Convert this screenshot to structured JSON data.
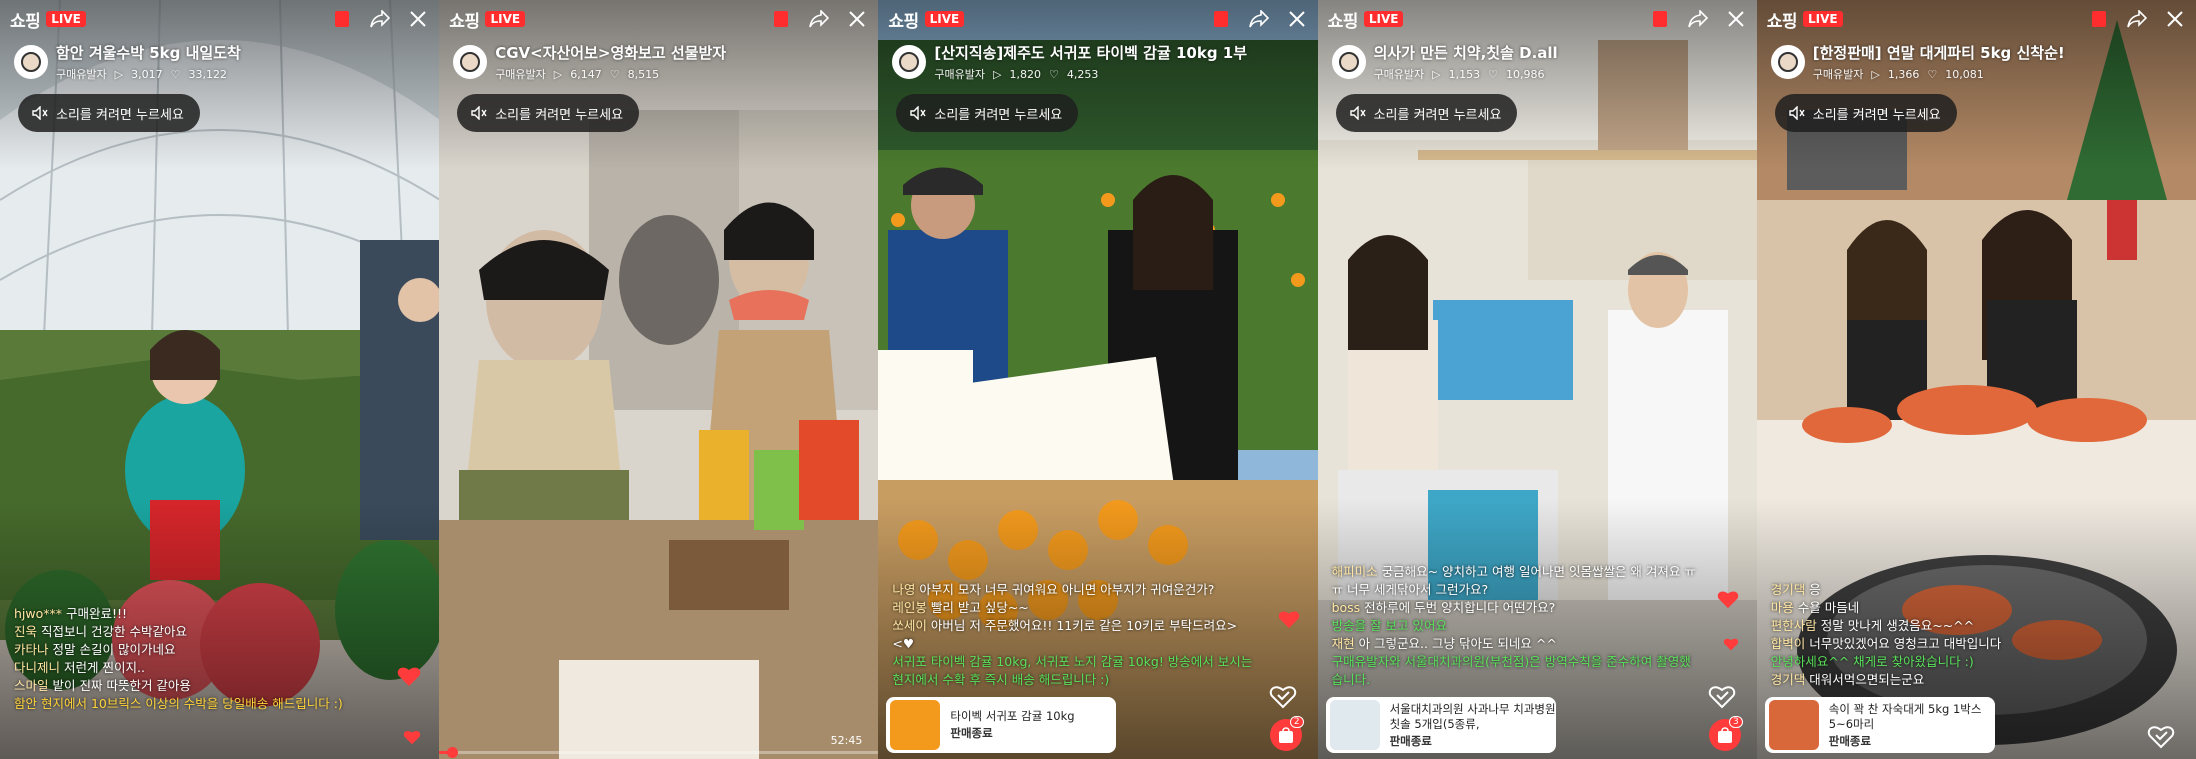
{
  "colors": {
    "live": "#ff2d2d",
    "accent": "#ff3b3b",
    "chat_green": "#59e05a",
    "chat_yellow": "#ffd33a"
  },
  "panels": [
    {
      "brand": "쇼핑",
      "live": "LIVE",
      "title": "함안 겨울수박 5kg 내일도착",
      "channel": "구매유발자",
      "plays": "3,017",
      "likes": "33,122",
      "sound": "소리를 켜려면 누르세요",
      "chat": [
        {
          "user": "hjwo***",
          "text": "구매완료!!!"
        },
        {
          "user": "진욱",
          "text": "직접보니 건강한 수박같아요"
        },
        {
          "user": "카타나",
          "text": "정말 손길이 많이가네요"
        },
        {
          "user": "다니제니",
          "text": "저런게 찐이지.."
        },
        {
          "user": "스마일",
          "text": "밭이 진짜 따뜻한거 같아용"
        },
        {
          "user": "",
          "text": "함안 현지에서 10브릭스 이상의 수박을 당일배송 해드립니다 :)"
        }
      ]
    },
    {
      "brand": "쇼핑",
      "live": "LIVE",
      "title": "CGV<자산어보>영화보고 선물받자",
      "channel": "구매유발자",
      "plays": "6,147",
      "likes": "8,515",
      "sound": "소리를 켜려면 누르세요",
      "time": "52:45",
      "progress": 0.03
    },
    {
      "brand": "쇼핑",
      "live": "LIVE",
      "title": "[산지직송]제주도 서귀포 타이벡 감귤 10kg 1부",
      "channel": "구매유발자",
      "plays": "1,820",
      "likes": "4,253",
      "sound": "소리를 켜려면 누르세요",
      "chat": [
        {
          "user": "나영",
          "text": "아부지 모자 너무 귀여워요 아니면 아부지가 귀여운건가?"
        },
        {
          "user": "레인봉",
          "text": "빨리 받고 싶당~~"
        },
        {
          "user": "쏘세이",
          "text": "아버님 저 주문했어요!! 11키로 같은 10키로 부탁드려요> <♥"
        },
        {
          "user": "",
          "text": "서귀포 타이벡 감귤 10kg, 서귀포 노지 감귤 10kg! 방송에서 보시는 현지에서 수확 후 즉시 배송 해드립니다 :)"
        }
      ],
      "product": {
        "title": "타이벡 서귀포 감귤 10kg",
        "status": "판매종료"
      },
      "cart_count": "2"
    },
    {
      "brand": "쇼핑",
      "live": "LIVE",
      "title": "의사가 만든 치약,칫솔 D.all",
      "channel": "구매유발자",
      "plays": "1,153",
      "likes": "10,986",
      "sound": "소리를 켜려면 누르세요",
      "chat": [
        {
          "user": "해피미소",
          "text": "궁금해요~ 양치하고 여행 일어나면 잇몸쌉쌀은 왜 겨져요 ㅠㅠ 너무 세게닦아서 그런가요?"
        },
        {
          "user": "boss",
          "text": "전하루에 두번 양치합니다 어떤가요?"
        },
        {
          "user": "",
          "text": "방송을 잘 보고 있어요"
        },
        {
          "user": "재현",
          "text": "아 그렇군요.. 그냥 닦아도 되네요 ^^"
        },
        {
          "user": "",
          "text": "구매유발자와 서울대치과의원(부천점)은 방역수칙을 준수하여 촬영했습니다."
        }
      ],
      "product": {
        "title": "서울대치과의원 사과나무 치과병원 칫솔 5개입(5종류,",
        "status": "판매종료"
      },
      "cart_count": "3"
    },
    {
      "brand": "쇼핑",
      "live": "LIVE",
      "title": "[한정판매] 연말 대게파티 5kg 신착순!",
      "channel": "구매유발자",
      "plays": "1,366",
      "likes": "10,081",
      "sound": "소리를 켜려면 누르세요",
      "chat": [
        {
          "user": "경기댁",
          "text": "응"
        },
        {
          "user": "마용",
          "text": "수욜 마듬네"
        },
        {
          "user": "편한사람",
          "text": "정말 맛나게 생겼음요~~^^"
        },
        {
          "user": "합벽이",
          "text": "너무맛있겠어요 영청크고 대박입니다"
        },
        {
          "user": "",
          "text": "안녕하세요^^ 채게로 찾아왔습니다 :)"
        },
        {
          "user": "경기댁",
          "text": "대워서먹으면되는군요"
        }
      ],
      "product": {
        "title": "속이 꽉 찬 자숙대게 5kg 1박스 5~6마리",
        "status": "판매종료"
      }
    }
  ]
}
